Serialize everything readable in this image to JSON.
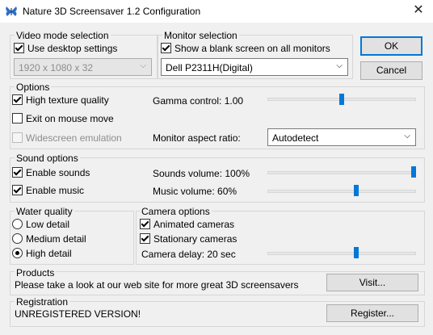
{
  "window": {
    "title": "Nature 3D Screensaver 1.2 Configuration",
    "close_symbol": "✕"
  },
  "video_mode": {
    "legend": "Video mode selection",
    "use_desktop_label": "Use desktop settings",
    "use_desktop_checked": true,
    "resolution_value": "1920 x 1080 x 32",
    "resolution_enabled": false
  },
  "monitor": {
    "legend": "Monitor selection",
    "blank_label": "Show a blank screen on all monitors",
    "blank_checked": true,
    "monitor_value": "Dell P2311H(Digital)"
  },
  "buttons": {
    "ok": "OK",
    "cancel": "Cancel",
    "visit": "Visit...",
    "register": "Register..."
  },
  "options": {
    "legend": "Options",
    "high_texture_label": "High texture quality",
    "high_texture_checked": true,
    "exit_mouse_label": "Exit on mouse move",
    "exit_mouse_checked": false,
    "widescreen_label": "Widescreen emulation",
    "widescreen_checked": false,
    "widescreen_enabled": false,
    "gamma_label": "Gamma control: 1.00",
    "gamma_level": 0.5,
    "aspect_label": "Monitor aspect ratio:",
    "aspect_value": "Autodetect"
  },
  "sound": {
    "legend": "Sound options",
    "enable_sounds_label": "Enable sounds",
    "enable_sounds_checked": true,
    "enable_music_label": "Enable music",
    "enable_music_checked": true,
    "sounds_volume_label": "Sounds volume: 100%",
    "sounds_volume_level": 1.0,
    "music_volume_label": "Music volume: 60%",
    "music_volume_level": 0.6
  },
  "water": {
    "legend": "Water quality",
    "items": [
      {
        "label": "Low detail",
        "selected": false
      },
      {
        "label": "Medium detail",
        "selected": false
      },
      {
        "label": "High detail",
        "selected": true
      }
    ]
  },
  "camera": {
    "legend": "Camera options",
    "animated_label": "Animated cameras",
    "animated_checked": true,
    "stationary_label": "Stationary cameras",
    "stationary_checked": true,
    "delay_label": "Camera delay: 20 sec",
    "delay_level": 0.6
  },
  "products": {
    "legend": "Products",
    "text": "Please take a look at our web site for more great 3D screensavers"
  },
  "registration": {
    "legend": "Registration",
    "status": "UNREGISTERED VERSION!"
  },
  "colors": {
    "accent": "#0078d7",
    "face": "#f0f0f0",
    "border": "#d6d6d6"
  },
  "icons": {
    "app": "butterfly-icon",
    "close": "close-icon",
    "dropdown": "chevron-down-icon"
  }
}
